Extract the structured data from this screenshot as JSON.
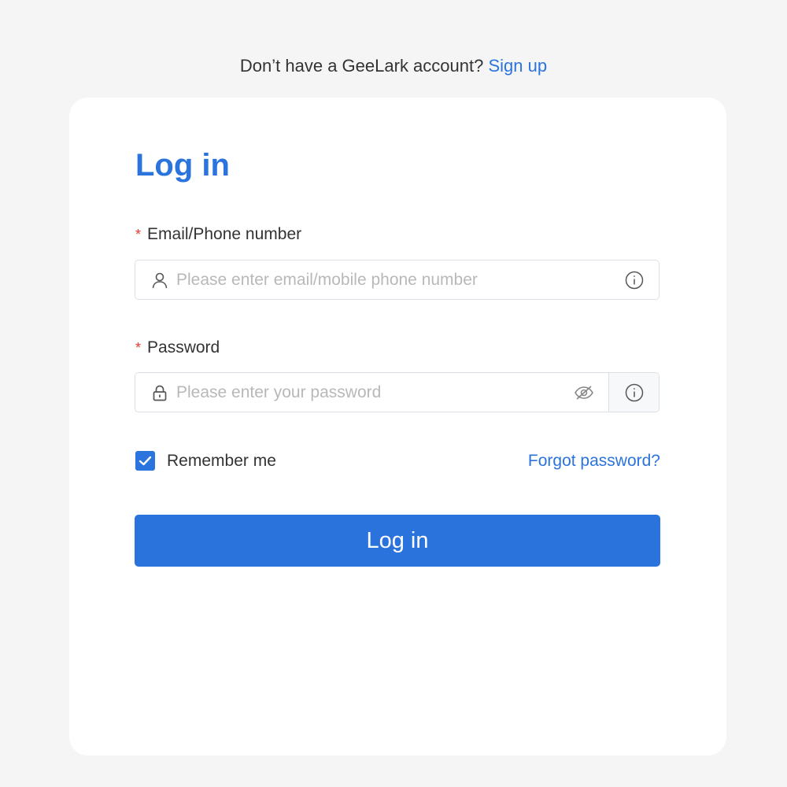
{
  "signup_prompt": {
    "text": "Don’t have a GeeLark account? ",
    "link_label": "Sign up"
  },
  "login_form": {
    "title": "Log in",
    "email": {
      "required_mark": "*",
      "label": "Email/Phone number",
      "value": "",
      "placeholder": "Please enter email/mobile phone number",
      "lead_icon": "user-icon",
      "trail_icon": "info-icon"
    },
    "password": {
      "required_mark": "*",
      "label": "Password",
      "value": "",
      "placeholder": "Please enter your password",
      "lead_icon": "lock-icon",
      "toggle_icon": "eye-off-icon",
      "addon_icon": "info-icon"
    },
    "remember_me": {
      "label": "Remember me",
      "checked": true
    },
    "forgot_password_label": "Forgot password?",
    "submit_label": "Log in"
  },
  "colors": {
    "accent": "#2b73dd",
    "required": "#e8362d",
    "background": "#f5f5f5",
    "card": "#ffffff"
  }
}
